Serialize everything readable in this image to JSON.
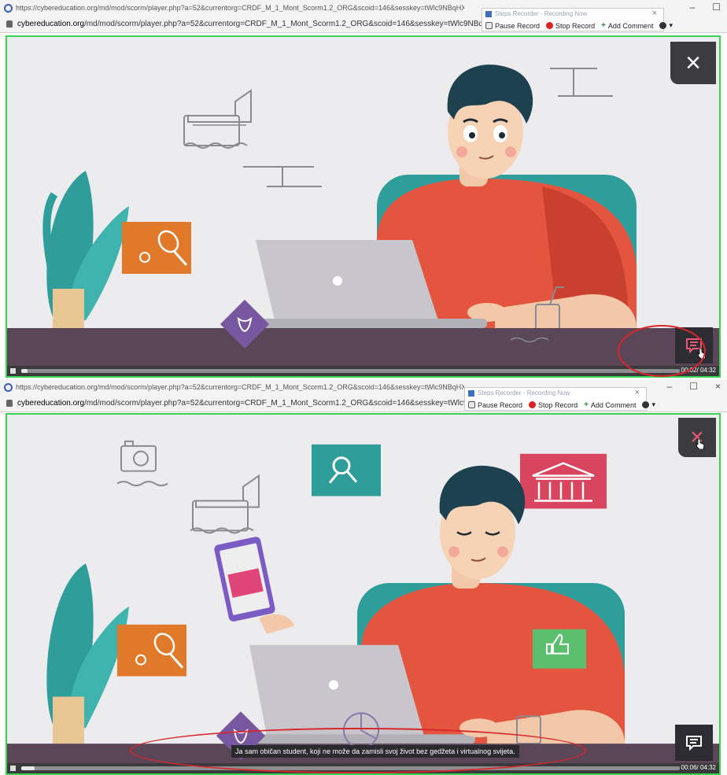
{
  "shot1": {
    "browser": {
      "title": "https://cybereducation.org/md/mod/scorm/player.php?a=52&currentorg=CRDF_M_1_Mont_Scorm1.2_ORG&scoid=146&sesskey=tWlc9NBqHX&display=popup&mode=normal - Google",
      "url_domain": "cybereducation.org",
      "url_path": "/md/mod/scorm/player.php?a=52&currentorg=CRDF_M_1_Mont_Scorm1.2_ORG&scoid=146&sesskey=tWlc9NBqHX&display=popup&mo"
    },
    "recorder": {
      "title": "Steps Recorder - Recording Now",
      "pause": "Pause Record",
      "stop": "Stop Record",
      "comment": "Add Comment"
    },
    "player": {
      "time": "00:02/ 04:32",
      "progress": 0.01
    }
  },
  "shot2": {
    "browser": {
      "title": "https://cybereducation.org/md/mod/scorm/player.php?a=52&currentorg=CRDF_M_1_Mont_Scorm1.2_ORG&scoid=146&sesskey=tWlc9NBqHX&display=popup&mode=normal - Google",
      "url_domain": "cybereducation.org",
      "url_path": "/md/mod/scorm/player.php?a=52&currentorg=CRDF_M_1_Mont_Scorm1.2_ORG&scoid=146&sesskey=tWlc9NBqHX&display=popup&mo"
    },
    "recorder": {
      "title": "Steps Recorder - Recording Now",
      "pause": "Pause Record",
      "stop": "Stop Record",
      "comment": "Add Comment"
    },
    "player": {
      "time": "00:06/ 04:32",
      "progress": 0.02,
      "caption": "Ja sam običan student, koji ne može da zamisli svoj život bez gedžeta i virtualnog svijeta."
    }
  },
  "colors": {
    "annotation": "#d8262a",
    "player_border": "#39d353",
    "shirt": "#e3553f",
    "desk": "#5b4658",
    "orange_card": "#e07a2a",
    "teal": "#2f9d99",
    "pink": "#d9445f",
    "green": "#5bbf6d"
  },
  "icons": [
    "close-icon",
    "closed-captions-icon",
    "cursor-hand-icon",
    "play-pause-icon",
    "lock-icon"
  ]
}
